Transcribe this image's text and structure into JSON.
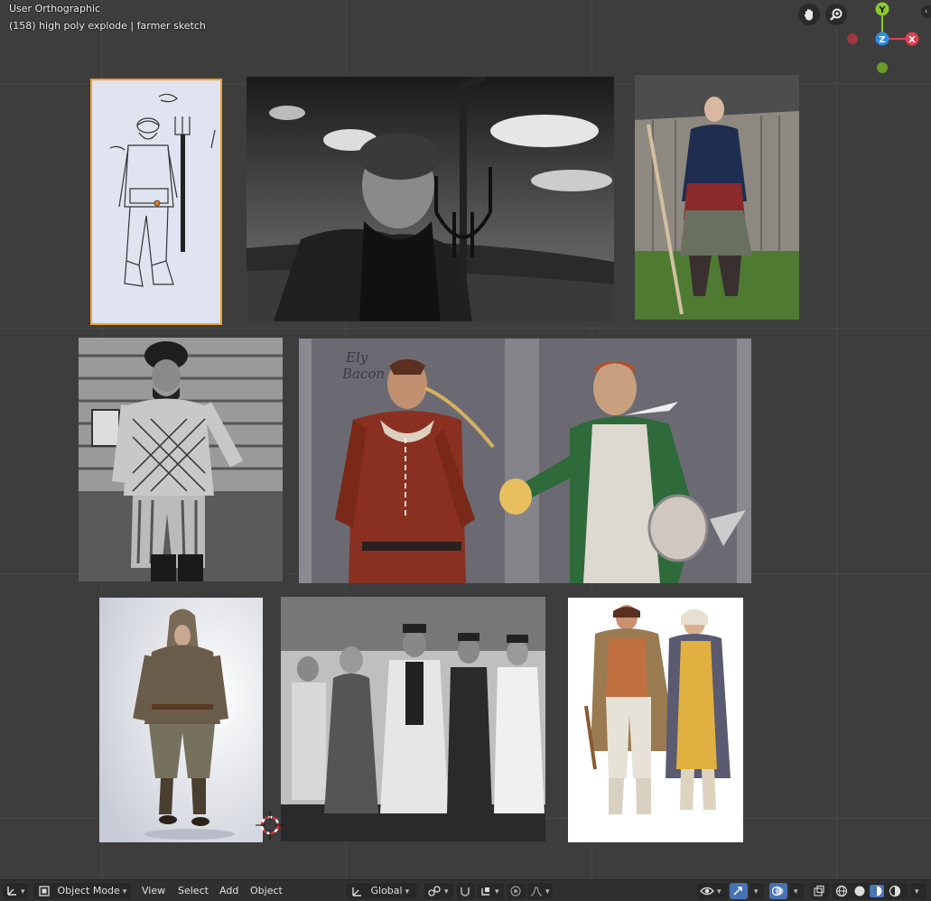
{
  "viewport": {
    "view_name": "User Orthographic",
    "object_info": "(158) high poly explode | farmer sketch"
  },
  "gizmo": {
    "y_label": "Y",
    "z_label": "Z",
    "x_label": "X",
    "y_color": "#8bc831",
    "z_color": "#2d8ce6",
    "x_color": "#e04050",
    "neg_x_color": "#a13542",
    "neg_y_color": "#6a9a2a"
  },
  "images": [
    {
      "name": "farmer-sketch",
      "selected": true
    },
    {
      "name": "old-man-pitchfork-photo"
    },
    {
      "name": "medieval-costume-man-photo"
    },
    {
      "name": "peasant-sweater-photo"
    },
    {
      "name": "concept-art-characters",
      "sketch_text": "Ely\nBacon"
    },
    {
      "name": "hooded-costume-photo"
    },
    {
      "name": "villagers-group-photo"
    },
    {
      "name": "illustrated-couple"
    }
  ],
  "header": {
    "mode": "Object Mode",
    "menu": [
      "View",
      "Select",
      "Add",
      "Object"
    ],
    "transform_orientation": "Global"
  },
  "colors": {
    "viewport_bg": "#3d3d3d",
    "header_bg": "#303030",
    "selection_outline": "#f0a030"
  }
}
